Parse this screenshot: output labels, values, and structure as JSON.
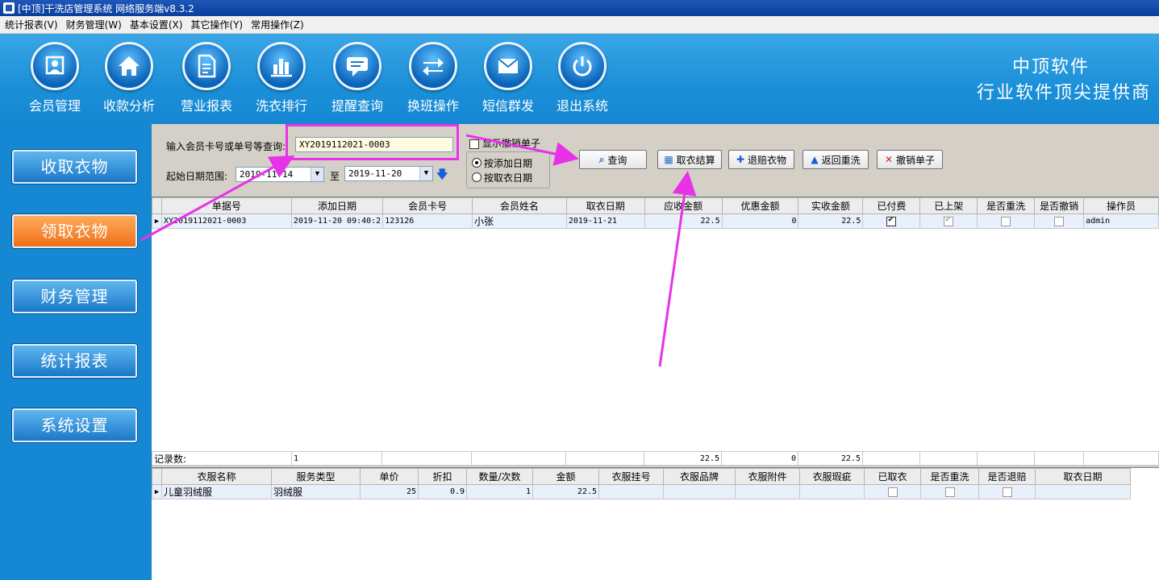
{
  "window": {
    "title": "[中顶]干洗店管理系统 网络服务端v8.3.2"
  },
  "menu": [
    {
      "label": "统计报表(V)"
    },
    {
      "label": "财务管理(W)"
    },
    {
      "label": "基本设置(X)"
    },
    {
      "label": "其它操作(Y)"
    },
    {
      "label": "常用操作(Z)"
    }
  ],
  "toolbar": [
    {
      "label": "会员管理",
      "icon": "member-icon"
    },
    {
      "label": "收款分析",
      "icon": "home-icon"
    },
    {
      "label": "营业报表",
      "icon": "report-icon"
    },
    {
      "label": "洗衣排行",
      "icon": "bar-chart-icon"
    },
    {
      "label": "提醒查询",
      "icon": "chat-bubble-icon"
    },
    {
      "label": "换班操作",
      "icon": "swap-arrows-icon"
    },
    {
      "label": "短信群发",
      "icon": "envelope-icon"
    },
    {
      "label": "退出系统",
      "icon": "power-icon"
    }
  ],
  "brand": {
    "line1": "中顶软件",
    "line2": "行业软件顶尖提供商"
  },
  "sidebar": [
    {
      "label": "收取衣物",
      "active": false
    },
    {
      "label": "领取衣物",
      "active": true
    },
    {
      "label": "财务管理",
      "active": false
    },
    {
      "label": "统计报表",
      "active": false
    },
    {
      "label": "系统设置",
      "active": false
    }
  ],
  "search": {
    "label": "输入会员卡号或单号等查询:",
    "value": "XY2019112021-0003",
    "show_cancelled_label": "显示撤销单子",
    "date_label": "起始日期范围:",
    "date_from": "2019-11-14",
    "date_to_label": "至",
    "date_to": "2019-11-20",
    "radio_add_date": "按添加日期",
    "radio_pickup_date": "按取衣日期"
  },
  "actions": [
    {
      "label": "查询",
      "icon": "magnifier-icon"
    },
    {
      "label": "取衣结算",
      "icon": "calendar-icon"
    },
    {
      "label": "退赔衣物",
      "icon": "plus-icon"
    },
    {
      "label": "返回重洗",
      "icon": "triangle-up-icon"
    },
    {
      "label": "撤销单子",
      "icon": "x-icon"
    }
  ],
  "orders": {
    "headers": [
      "单据号",
      "添加日期",
      "会员卡号",
      "会员姓名",
      "取衣日期",
      "应收金额",
      "优惠金额",
      "实收金额",
      "已付费",
      "已上架",
      "是否重洗",
      "是否撤销",
      "操作员"
    ],
    "rows": [
      {
        "order_no": "XY2019112021-0003",
        "add_date": "2019-11-20 09:40:2",
        "card_no": "123126",
        "name": "小张",
        "pickup_date": "2019-11-21",
        "receivable": "22.5",
        "discount": "0",
        "received": "22.5",
        "paid": true,
        "shelved": true,
        "rewash": false,
        "cancelled": false,
        "operator": "admin"
      }
    ],
    "footer": {
      "label": "记录数:",
      "count": "1",
      "receivable": "22.5",
      "discount": "0",
      "received": "22.5"
    }
  },
  "items": {
    "headers": [
      "衣服名称",
      "服务类型",
      "单价",
      "折扣",
      "数量/次数",
      "金额",
      "衣服挂号",
      "衣服品牌",
      "衣服附件",
      "衣服瑕疵",
      "已取衣",
      "是否重洗",
      "是否退赔",
      "取衣日期"
    ],
    "rows": [
      {
        "name": "儿童羽绒服",
        "service": "羽绒服",
        "price": "25",
        "discount": "0.9",
        "qty": "1",
        "amount": "22.5",
        "tag": "",
        "brand": "",
        "accessory": "",
        "defect": "",
        "picked": false,
        "rewash": false,
        "refund": false,
        "pickup_date": ""
      }
    ]
  },
  "colors": {
    "accent": "#1687d2",
    "active_side": "#f0701a",
    "highlight": "#e832e8"
  }
}
